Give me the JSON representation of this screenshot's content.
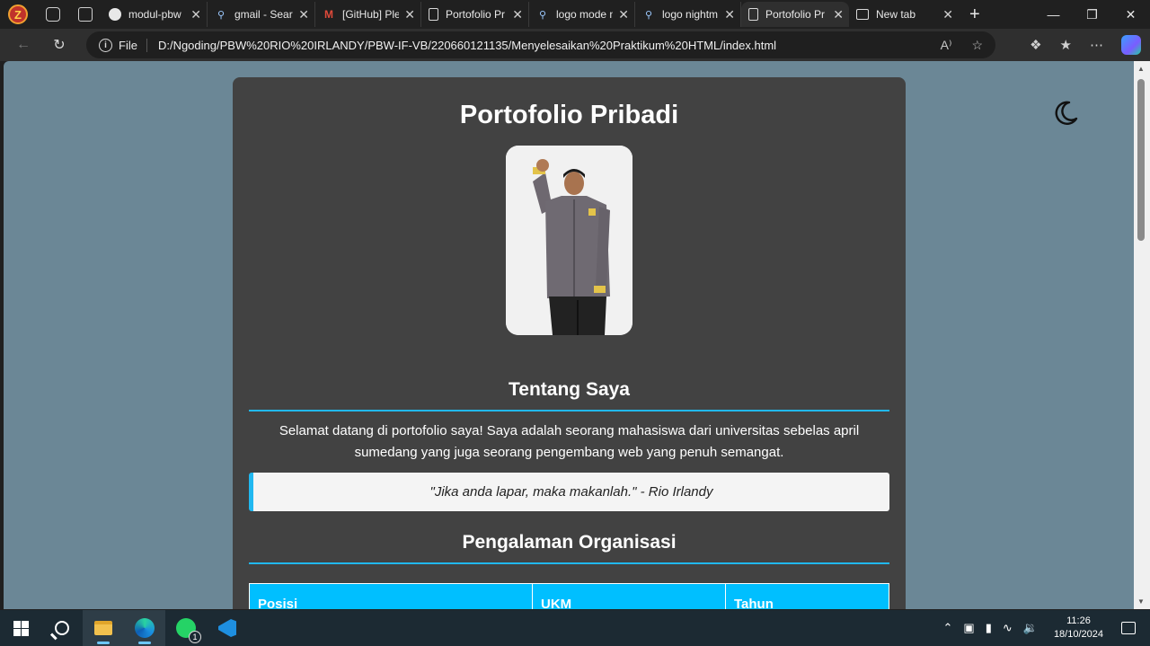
{
  "browser": {
    "tabs": [
      {
        "title": "modul-pbw",
        "icon": "github-icon",
        "active": false
      },
      {
        "title": "gmail - Sear",
        "icon": "search-icon",
        "active": false
      },
      {
        "title": "[GitHub] Ple",
        "icon": "gmail-icon",
        "active": false
      },
      {
        "title": "Portofolio Pr",
        "icon": "page-icon",
        "active": false
      },
      {
        "title": "logo mode n",
        "icon": "search-icon",
        "active": false
      },
      {
        "title": "logo nightm",
        "icon": "search-icon",
        "active": false
      },
      {
        "title": "Portofolio Pr",
        "icon": "page-icon",
        "active": true
      },
      {
        "title": "New tab",
        "icon": "newtab-icon",
        "active": false
      }
    ],
    "address": {
      "scheme_label": "File",
      "url": "D:/Ngoding/PBW%20RIO%20IRLANDY/PBW-IF-VB/220660121135/Menyelesaikan%20Praktikum%20HTML/index.html"
    }
  },
  "page": {
    "title": "Portofolio Pribadi",
    "about": {
      "heading": "Tentang Saya",
      "text": "Selamat datang di portofolio saya! Saya adalah seorang mahasiswa dari universitas sebelas april sumedang yang juga seorang pengembang web yang penuh semangat.",
      "quote": "\"Jika anda lapar, maka makanlah.\" - Rio Irlandy"
    },
    "organization": {
      "heading": "Pengalaman Organisasi",
      "columns": [
        "Posisi",
        "UKM",
        "Tahun"
      ]
    },
    "theme_toggle": "night-mode"
  },
  "colors": {
    "page_background": "#6b8796",
    "card_background": "#424242",
    "accent": "#21b8f0",
    "table_header": "#00bfff"
  },
  "taskbar": {
    "time": "11:26",
    "date": "18/10/2024",
    "whatsapp_badge": "1"
  }
}
